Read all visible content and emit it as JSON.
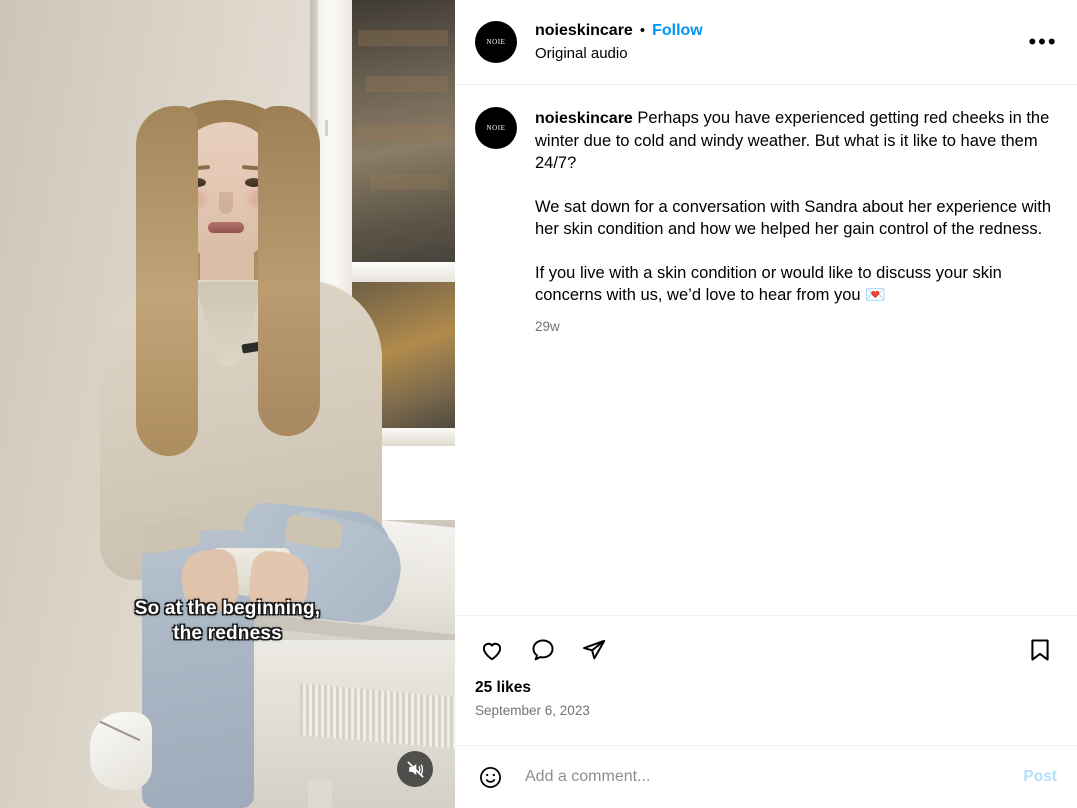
{
  "header": {
    "avatar_text": "NOIE",
    "username": "noieskincare",
    "separator": "•",
    "follow_label": "Follow",
    "audio_label": "Original audio",
    "more_glyph": "•••"
  },
  "caption": {
    "avatar_text": "NOIE",
    "username": "noieskincare",
    "paragraph1": "Perhaps you have experienced getting red cheeks in the winter due to cold and windy weather. But what is it like to have them 24/7?",
    "paragraph2": "We sat down for a conversation with Sandra about her experience with her skin condition and how we helped her gain control of the redness.",
    "paragraph3": "If you live with a skin condition or would like to discuss your skin concerns with us, we’d love to hear from you 💌",
    "timestamp": "29w"
  },
  "actions": {
    "like_icon": "heart-icon",
    "comment_icon": "comment-icon",
    "share_icon": "share-icon",
    "save_icon": "bookmark-icon",
    "likes_count": "25 likes",
    "post_date": "September 6, 2023"
  },
  "comment_bar": {
    "emoji_icon": "emoji-smiley-icon",
    "placeholder": "Add a comment...",
    "post_label": "Post"
  },
  "video": {
    "subtitle": "So at the beginning,\nthe redness",
    "mute_icon": "speaker-muted-icon"
  },
  "colors": {
    "accent_blue": "#0095F6",
    "post_disabled_blue": "#B2DFFC",
    "secondary_text": "#737373",
    "divider": "#EFEFEF"
  }
}
